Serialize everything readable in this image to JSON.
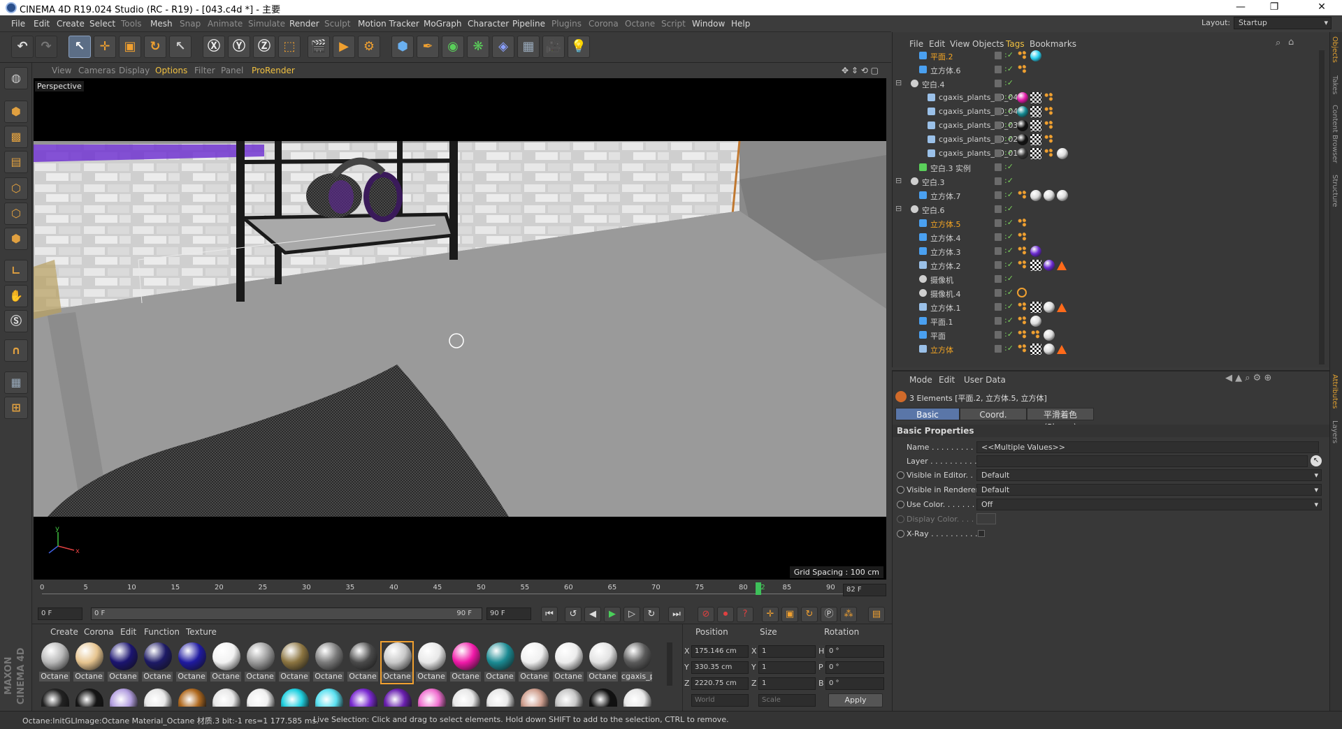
{
  "window": {
    "title": "CINEMA 4D R19.024 Studio (RC - R19) - [043.c4d *] - 主要"
  },
  "menu": [
    "File",
    "Edit",
    "Create",
    "Select",
    "Tools",
    "Mesh",
    "Snap",
    "Animate",
    "Simulate",
    "Render",
    "Sculpt",
    "Motion Tracker",
    "MoGraph",
    "Character",
    "Pipeline",
    "Plugins",
    "Corona",
    "Octane",
    "Script",
    "Window",
    "Help"
  ],
  "layout": {
    "label": "Layout:",
    "value": "Startup"
  },
  "viewport": {
    "menu": [
      "View",
      "Cameras",
      "Display",
      "Options",
      "Filter",
      "Panel",
      "ProRender"
    ],
    "camera_label": "Perspective",
    "grid_spacing": "Grid Spacing : 100 cm"
  },
  "timeline": {
    "ticks": [
      "0",
      "5",
      "10",
      "15",
      "20",
      "25",
      "30",
      "35",
      "40",
      "45",
      "50",
      "55",
      "60",
      "65",
      "70",
      "75",
      "80",
      "82",
      "85",
      "90"
    ],
    "current_frame": "82 F",
    "start_field": "0 F",
    "range_start": "0 F",
    "range_end": "90 F",
    "end_field": "90 F",
    "playhead_fraction": 0.911
  },
  "material_manager": {
    "menu": [
      "Create",
      "Corona",
      "Edit",
      "Function",
      "Texture"
    ],
    "materials": [
      {
        "label": "Octane",
        "color": "#b8b8b8"
      },
      {
        "label": "Octane",
        "color": "#e6c48f"
      },
      {
        "label": "Octane",
        "color": "#1b1470"
      },
      {
        "label": "Octane",
        "color": "#1d1a66"
      },
      {
        "label": "Octane",
        "color": "#1f1aa0"
      },
      {
        "label": "Octane",
        "color": "#f2f2f2"
      },
      {
        "label": "Octane",
        "color": "#9a9a9a"
      },
      {
        "label": "Octane",
        "color": "#8b7440"
      },
      {
        "label": "Octane",
        "color": "#7a7a7a"
      },
      {
        "label": "Octane",
        "color": "#4a4a4a"
      },
      {
        "label": "Octane",
        "color": "#c8c8c8"
      },
      {
        "label": "Octane",
        "color": "#e8e8e8"
      },
      {
        "label": "Octane",
        "color": "#f018a8"
      },
      {
        "label": "Octane",
        "color": "#1a8a92"
      },
      {
        "label": "Octane",
        "color": "#f0f0f0"
      },
      {
        "label": "Octane",
        "color": "#ececec"
      },
      {
        "label": "Octane",
        "color": "#e2e2e2"
      },
      {
        "label": "cgaxis_p",
        "color": "#5a5a5a"
      }
    ]
  },
  "coordinates": {
    "headers": [
      "Position",
      "Size",
      "Rotation"
    ],
    "rows": [
      {
        "axis": "X",
        "pos": "175.146 cm",
        "size_axis": "X",
        "size": "1",
        "rot_axis": "H",
        "rot": "0 °"
      },
      {
        "axis": "Y",
        "pos": "330.35 cm",
        "size_axis": "Y",
        "size": "1",
        "rot_axis": "P",
        "rot": "0 °"
      },
      {
        "axis": "Z",
        "pos": "2220.75 cm",
        "size_axis": "Z",
        "size": "1",
        "rot_axis": "B",
        "rot": "0 °"
      }
    ],
    "space": "World",
    "mode": "Scale",
    "apply": "Apply"
  },
  "object_manager": {
    "menu": [
      "File",
      "Edit",
      "View",
      "Objects",
      "Tags",
      "Bookmarks"
    ],
    "rows": [
      {
        "name": "平面.2",
        "selected": true,
        "indent": 1,
        "icon": "plane"
      },
      {
        "name": "立方体.6",
        "selected": false,
        "indent": 1,
        "icon": "cube"
      },
      {
        "name": "空白.4",
        "selected": false,
        "indent": 0,
        "icon": "null"
      },
      {
        "name": "cgaxis_plants_10_04.1",
        "selected": false,
        "indent": 2,
        "icon": "poly"
      },
      {
        "name": "cgaxis_plants_10_04",
        "selected": false,
        "indent": 2,
        "icon": "poly"
      },
      {
        "name": "cgaxis_plants_10_03",
        "selected": false,
        "indent": 2,
        "icon": "poly"
      },
      {
        "name": "cgaxis_plants_10_02",
        "selected": false,
        "indent": 2,
        "icon": "poly"
      },
      {
        "name": "cgaxis_plants_10_01",
        "selected": false,
        "indent": 2,
        "icon": "poly"
      },
      {
        "name": "空白.3 实例",
        "selected": false,
        "indent": 1,
        "icon": "instance"
      },
      {
        "name": "空白.3",
        "selected": false,
        "indent": 0,
        "icon": "null"
      },
      {
        "name": "立方体.7",
        "selected": false,
        "indent": 1,
        "icon": "cube"
      },
      {
        "name": "空白.6",
        "selected": false,
        "indent": 0,
        "icon": "null"
      },
      {
        "name": "立方体.5",
        "selected": true,
        "indent": 1,
        "icon": "cube"
      },
      {
        "name": "立方体.4",
        "selected": false,
        "indent": 1,
        "icon": "cube"
      },
      {
        "name": "立方体.3",
        "selected": false,
        "indent": 1,
        "icon": "cube"
      },
      {
        "name": "立方体.2",
        "selected": false,
        "indent": 1,
        "icon": "poly"
      },
      {
        "name": "摄像机",
        "selected": false,
        "indent": 1,
        "icon": "camera"
      },
      {
        "name": "摄像机.4",
        "selected": false,
        "indent": 1,
        "icon": "camera"
      },
      {
        "name": "立方体.1",
        "selected": false,
        "indent": 1,
        "icon": "poly"
      },
      {
        "name": "平面.1",
        "selected": false,
        "indent": 1,
        "icon": "plane"
      },
      {
        "name": "平面",
        "selected": false,
        "indent": 1,
        "icon": "plane"
      },
      {
        "name": "立方体",
        "selected": true,
        "indent": 1,
        "icon": "poly"
      }
    ]
  },
  "attributes": {
    "menu": [
      "Mode",
      "Edit",
      "User Data"
    ],
    "selection": "3 Elements [平面.2, 立方体.5, 立方体]",
    "tabs": [
      "Basic",
      "Coord.",
      "平滑着色(Phong)"
    ],
    "section": "Basic Properties",
    "props": [
      {
        "label": "Name . . . . . . . . . . . .",
        "value": "<<Multiple Values>>"
      },
      {
        "label": "Layer . . . . . . . . . . . .",
        "value": ""
      },
      {
        "label": "Visible in Editor. .",
        "value": "Default"
      },
      {
        "label": "Visible in Renderer",
        "value": "Default"
      },
      {
        "label": "Use Color. . . . . . . .",
        "value": "Off"
      },
      {
        "label": "Display Color. . . .",
        "value": ""
      },
      {
        "label": "X-Ray . . . . . . . . . . .",
        "value": ""
      }
    ]
  },
  "side_tabs": [
    "Objects",
    "Takes",
    "Content Browser",
    "Structure",
    "Attributes",
    "Layers"
  ],
  "status": {
    "left": "Octane:InitGLImage:Octane Material_Octane 材质.3  bit:-1 res=1  177.585 ms.",
    "hint": "Live Selection: Click and drag to select elements. Hold down SHIFT to add to the selection, CTRL to remove."
  },
  "colors": {
    "accent": "#f0c040",
    "selected_object": "#f5a623",
    "active_tab": "#5a76a8"
  }
}
